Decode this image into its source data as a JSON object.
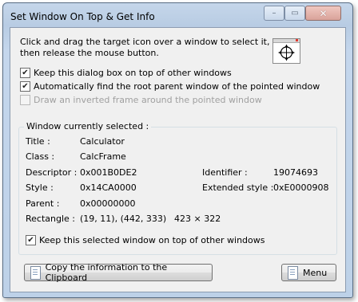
{
  "window": {
    "title": "Set Window On Top & Get Info",
    "minimize_glyph": "–",
    "maximize_glyph": "▭",
    "close_glyph": "✕"
  },
  "instructions": "Click and drag the target icon over a window to select it,\nthen release the mouse button.",
  "options": {
    "keep_on_top": {
      "label": "Keep this dialog box on top of other windows",
      "checked": true
    },
    "find_root_parent": {
      "label": "Automatically find the root parent window of the pointed window",
      "checked": true
    },
    "draw_inverted_frame": {
      "label": "Draw an inverted frame around the pointed window",
      "checked": false,
      "disabled": true
    }
  },
  "selected": {
    "group_title": "Window currently selected :",
    "title_label": "Title :",
    "title_value": "Calculator",
    "class_label": "Class :",
    "class_value": "CalcFrame",
    "descriptor_label": "Descriptor :",
    "descriptor_value": "0x001B0DE2",
    "identifier_label": "Identifier :",
    "identifier_value": "19074693",
    "style_label": "Style :",
    "style_value": "0x14CA0000",
    "ext_style_label": "Extended style :",
    "ext_style_value": "0xE0000908",
    "parent_label": "Parent :",
    "parent_value": "0x00000000",
    "rectangle_label": "Rectangle :",
    "rectangle_value": "(19, 11), (442, 333)",
    "rectangle_size": "423 × 322",
    "keep_selected_on_top": {
      "label": "Keep this selected window on top of other windows",
      "checked": true
    }
  },
  "buttons": {
    "copy_label": "Copy the information to the Clipboard",
    "menu_label": "Menu"
  },
  "check_glyph": "✔"
}
